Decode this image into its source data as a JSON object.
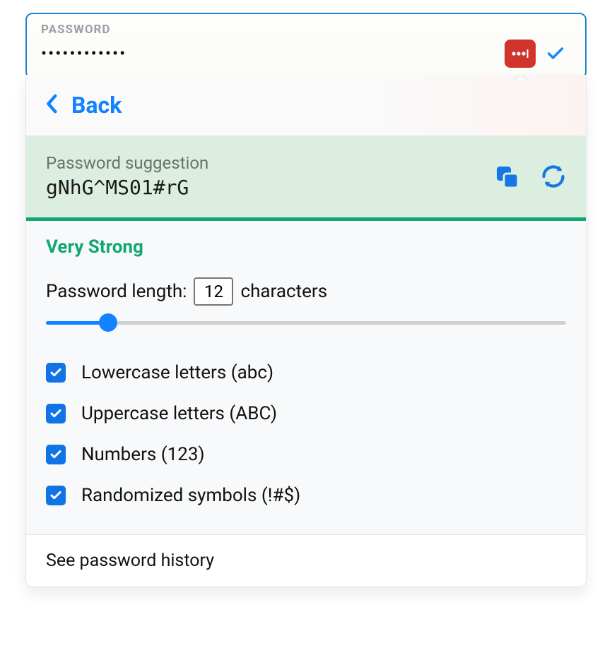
{
  "field": {
    "label": "PASSWORD",
    "masked_value": "••••••••••••"
  },
  "popup": {
    "back_label": "Back",
    "suggestion_label": "Password suggestion",
    "suggestion_value": "gNhG^MS01#rG",
    "strength": "Very Strong",
    "length_label_prefix": "Password length:",
    "length_value": "12",
    "length_label_suffix": "characters",
    "slider_percent": 12,
    "options": [
      {
        "label": "Lowercase letters (abc)",
        "checked": true
      },
      {
        "label": "Uppercase letters (ABC)",
        "checked": true
      },
      {
        "label": "Numbers (123)",
        "checked": true
      },
      {
        "label": "Randomized symbols (!#$)",
        "checked": true
      }
    ],
    "history_label": "See password history"
  }
}
